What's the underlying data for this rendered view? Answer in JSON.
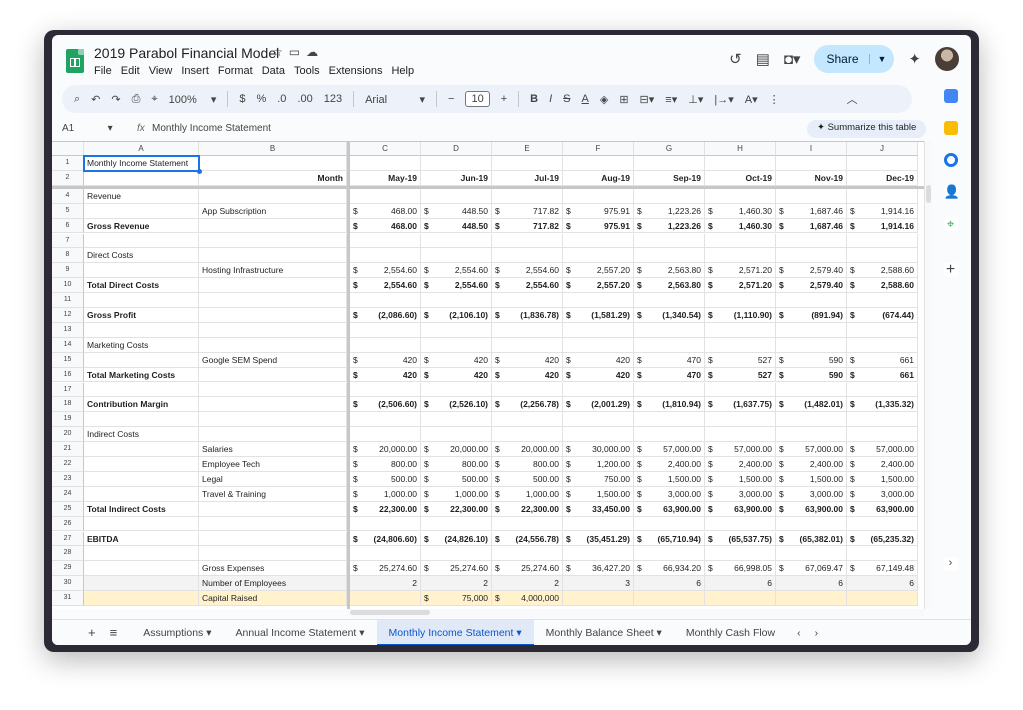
{
  "doc": {
    "title": "2019 Parabol Financial Model"
  },
  "menus": [
    "File",
    "Edit",
    "View",
    "Insert",
    "Format",
    "Data",
    "Tools",
    "Extensions",
    "Help"
  ],
  "share_label": "Share",
  "toolbar": {
    "zoom": "100%",
    "currency": "$",
    "percent": "%",
    "dec_less": ".0",
    "dec_more": ".00",
    "numfmt": "123",
    "font": "Arial",
    "size": "10"
  },
  "formula": {
    "cell_ref": "A1",
    "fx": "fx",
    "value": "Monthly Income Statement",
    "summarize": "✦ Summarize this table"
  },
  "columns": [
    "A",
    "B",
    "C",
    "D",
    "E",
    "F",
    "G",
    "H",
    "I",
    "J"
  ],
  "months": [
    "May-19",
    "Jun-19",
    "Jul-19",
    "Aug-19",
    "Sep-19",
    "Oct-19",
    "Nov-19",
    "Dec-19"
  ],
  "month_label": "Month",
  "rows": [
    {
      "n": "1",
      "a": "Monthly Income Statement",
      "b": "",
      "vals": null,
      "bold": false,
      "dollar": false
    },
    {
      "n": "2",
      "a": "",
      "b": "",
      "vals": null,
      "bold": false,
      "dollar": false,
      "header": true
    },
    {
      "n": "4",
      "a": "Revenue",
      "b": "",
      "vals": null,
      "bold": false,
      "dollar": false
    },
    {
      "n": "5",
      "a": "",
      "b": "App Subscription",
      "vals": [
        "468.00",
        "448.50",
        "717.82",
        "975.91",
        "1,223.26",
        "1,460.30",
        "1,687.46",
        "1,914.16"
      ],
      "bold": false,
      "dollar": true
    },
    {
      "n": "6",
      "a": "Gross Revenue",
      "b": "",
      "vals": [
        "468.00",
        "448.50",
        "717.82",
        "975.91",
        "1,223.26",
        "1,460.30",
        "1,687.46",
        "1,914.16"
      ],
      "bold": true,
      "dollar": true
    },
    {
      "n": "7",
      "a": "",
      "b": "",
      "vals": null,
      "bold": false,
      "dollar": false
    },
    {
      "n": "8",
      "a": "Direct Costs",
      "b": "",
      "vals": null,
      "bold": false,
      "dollar": false
    },
    {
      "n": "9",
      "a": "",
      "b": "Hosting Infrastructure",
      "vals": [
        "2,554.60",
        "2,554.60",
        "2,554.60",
        "2,557.20",
        "2,563.80",
        "2,571.20",
        "2,579.40",
        "2,588.60"
      ],
      "bold": false,
      "dollar": true
    },
    {
      "n": "10",
      "a": "Total Direct Costs",
      "b": "",
      "vals": [
        "2,554.60",
        "2,554.60",
        "2,554.60",
        "2,557.20",
        "2,563.80",
        "2,571.20",
        "2,579.40",
        "2,588.60"
      ],
      "bold": true,
      "dollar": true
    },
    {
      "n": "11",
      "a": "",
      "b": "",
      "vals": null,
      "bold": false,
      "dollar": false
    },
    {
      "n": "12",
      "a": "Gross Profit",
      "b": "",
      "vals": [
        "(2,086.60)",
        "(2,106.10)",
        "(1,836.78)",
        "(1,581.29)",
        "(1,340.54)",
        "(1,110.90)",
        "(891.94)",
        "(674.44)"
      ],
      "bold": true,
      "dollar": true
    },
    {
      "n": "13",
      "a": "",
      "b": "",
      "vals": null,
      "bold": false,
      "dollar": false
    },
    {
      "n": "14",
      "a": "Marketing Costs",
      "b": "",
      "vals": null,
      "bold": false,
      "dollar": false
    },
    {
      "n": "15",
      "a": "",
      "b": "Google SEM Spend",
      "vals": [
        "420",
        "420",
        "420",
        "420",
        "470",
        "527",
        "590",
        "661"
      ],
      "bold": false,
      "dollar": true
    },
    {
      "n": "16",
      "a": "Total Marketing Costs",
      "b": "",
      "vals": [
        "420",
        "420",
        "420",
        "420",
        "470",
        "527",
        "590",
        "661"
      ],
      "bold": true,
      "dollar": true
    },
    {
      "n": "17",
      "a": "",
      "b": "",
      "vals": null,
      "bold": false,
      "dollar": false
    },
    {
      "n": "18",
      "a": "Contribution Margin",
      "b": "",
      "vals": [
        "(2,506.60)",
        "(2,526.10)",
        "(2,256.78)",
        "(2,001.29)",
        "(1,810.94)",
        "(1,637.75)",
        "(1,482.01)",
        "(1,335.32)"
      ],
      "bold": true,
      "dollar": true
    },
    {
      "n": "19",
      "a": "",
      "b": "",
      "vals": null,
      "bold": false,
      "dollar": false
    },
    {
      "n": "20",
      "a": "Indirect Costs",
      "b": "",
      "vals": null,
      "bold": false,
      "dollar": false
    },
    {
      "n": "21",
      "a": "",
      "b": "Salaries",
      "vals": [
        "20,000.00",
        "20,000.00",
        "20,000.00",
        "30,000.00",
        "57,000.00",
        "57,000.00",
        "57,000.00",
        "57,000.00"
      ],
      "bold": false,
      "dollar": true
    },
    {
      "n": "22",
      "a": "",
      "b": "Employee Tech",
      "vals": [
        "800.00",
        "800.00",
        "800.00",
        "1,200.00",
        "2,400.00",
        "2,400.00",
        "2,400.00",
        "2,400.00"
      ],
      "bold": false,
      "dollar": true
    },
    {
      "n": "23",
      "a": "",
      "b": "Legal",
      "vals": [
        "500.00",
        "500.00",
        "500.00",
        "750.00",
        "1,500.00",
        "1,500.00",
        "1,500.00",
        "1,500.00"
      ],
      "bold": false,
      "dollar": true
    },
    {
      "n": "24",
      "a": "",
      "b": "Travel & Training",
      "vals": [
        "1,000.00",
        "1,000.00",
        "1,000.00",
        "1,500.00",
        "3,000.00",
        "3,000.00",
        "3,000.00",
        "3,000.00"
      ],
      "bold": false,
      "dollar": true
    },
    {
      "n": "25",
      "a": "Total Indirect Costs",
      "b": "",
      "vals": [
        "22,300.00",
        "22,300.00",
        "22,300.00",
        "33,450.00",
        "63,900.00",
        "63,900.00",
        "63,900.00",
        "63,900.00"
      ],
      "bold": true,
      "dollar": true
    },
    {
      "n": "26",
      "a": "",
      "b": "",
      "vals": null,
      "bold": false,
      "dollar": false
    },
    {
      "n": "27",
      "a": "EBITDA",
      "b": "",
      "vals": [
        "(24,806.60)",
        "(24,826.10)",
        "(24,556.78)",
        "(35,451.29)",
        "(65,710.94)",
        "(65,537.75)",
        "(65,382.01)",
        "(65,235.32)"
      ],
      "bold": true,
      "dollar": true
    },
    {
      "n": "28",
      "a": "",
      "b": "",
      "vals": null,
      "bold": false,
      "dollar": false
    },
    {
      "n": "29",
      "a": "",
      "b": "Gross Expenses",
      "vals": [
        "25,274.60",
        "25,274.60",
        "25,274.60",
        "36,427.20",
        "66,934.20",
        "66,998.05",
        "67,069.47",
        "67,149.48"
      ],
      "bold": false,
      "dollar": true
    },
    {
      "n": "30",
      "a": "",
      "b": "Number of Employees",
      "vals": [
        "2",
        "2",
        "2",
        "3",
        "6",
        "6",
        "6",
        "6"
      ],
      "bold": false,
      "dollar": false,
      "shade": "#f3f3f3"
    },
    {
      "n": "31",
      "a": "",
      "b": "Capital Raised",
      "vals": [
        "",
        "75,000",
        "4,000,000",
        "",
        "",
        "",
        "",
        ""
      ],
      "bold": false,
      "dollar": "partial",
      "shade": "#fff2cc"
    }
  ],
  "tabs": [
    "Assumptions",
    "Annual Income Statement",
    "Monthly Income Statement",
    "Monthly Balance Sheet",
    "Monthly Cash Flow"
  ],
  "active_tab": "Monthly Income Statement",
  "colors": {
    "accent": "#0b57d0",
    "sheets_green": "#1ea362"
  }
}
